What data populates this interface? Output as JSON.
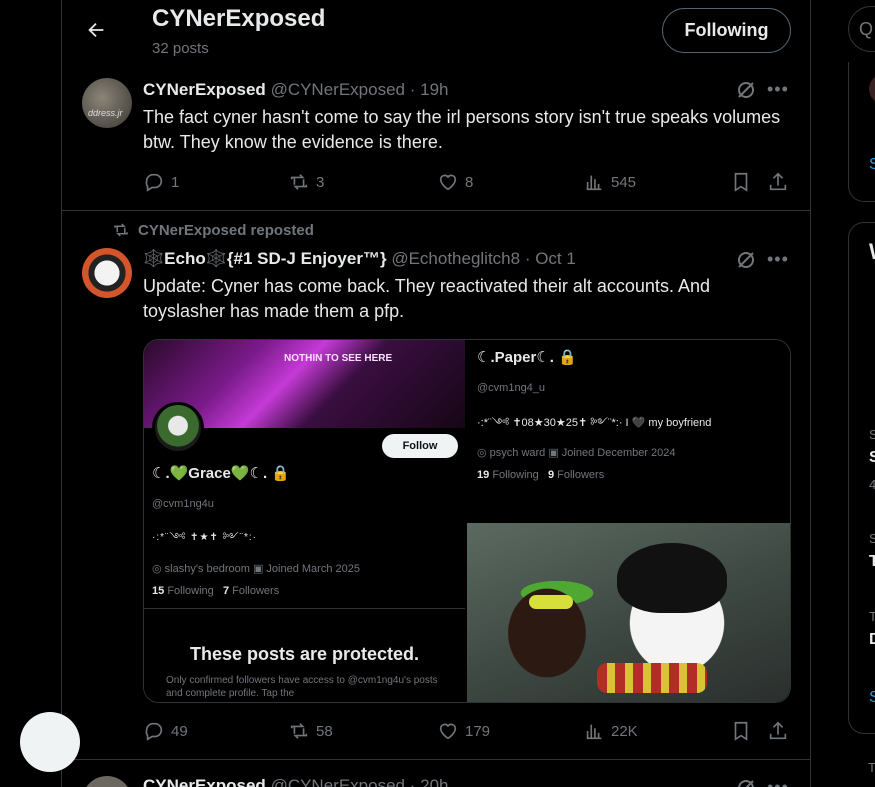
{
  "header": {
    "title": "CYNerExposed",
    "posts_count": "32 posts",
    "follow_button": "Following"
  },
  "post1": {
    "avatar_text": "ddress.jr",
    "name": "CYNerExposed",
    "handle": "@CYNerExposed",
    "time": "· 19h",
    "text": "The fact cyner hasn't come to say the irl persons story isn't true speaks volumes btw. They know the evidence is there.",
    "replies": "1",
    "reposts": "3",
    "likes": "8",
    "views": "545"
  },
  "post2": {
    "repost_label": "CYNerExposed reposted",
    "name": "🕸️Echo🕸️{#1 SD-J Enjoyer™}",
    "handle": "@Echotheglitch8",
    "time": "· Oct 1",
    "text": "Update: Cyner has come back. They reactivated their alt accounts. And toyslasher has made them a pfp.",
    "replies": "49",
    "reposts": "58",
    "likes": "179",
    "views": "22K",
    "media": {
      "left": {
        "banner_text": "NOTHIN TO SEE HERE",
        "follow": "Follow",
        "name": "☾.💚Grace💚☾. 🔒",
        "handle": "@cvm1ng4u",
        "bio": "·:*¨༺ ✝★✝ ༻¨*:·",
        "location": "◎ slashy's bedroom   ▣ Joined March 2025",
        "following_count": "15",
        "following_label": "Following",
        "followers_count": "7",
        "followers_label": "Followers",
        "protected_title": "These posts are protected.",
        "protected_body": "Only confirmed followers have access to @cvm1ng4u's posts and complete profile. Tap the"
      },
      "right": {
        "name": "☾.Paper☾. 🔒",
        "handle": "@cvm1ng4_u",
        "bio": "·:*¨༺ ✝08★30★25✝ ༻¨*:· I 🖤 my boyfriend",
        "location": "◎ psych ward   ▣ Joined December 2024",
        "following_count": "19",
        "following_label": "Following",
        "followers_count": "9",
        "followers_label": "Followers"
      }
    }
  },
  "post3": {
    "name": "CYNerExposed",
    "handle": "@CYNerExposed",
    "time": "· 20h"
  },
  "rail": {
    "search_icon": "Q",
    "s1": "S",
    "w": "W",
    "s2": "S",
    "s3": "S",
    "n4": "4",
    "s4": "S",
    "t1": "T",
    "t2": "T",
    "d1": "D",
    "s5": "S",
    "t3": "T"
  },
  "colors": {
    "background": "#000000",
    "border": "#2f3336",
    "muted": "#71767b",
    "text": "#e7e9ea",
    "link": "#1d9bf0"
  }
}
